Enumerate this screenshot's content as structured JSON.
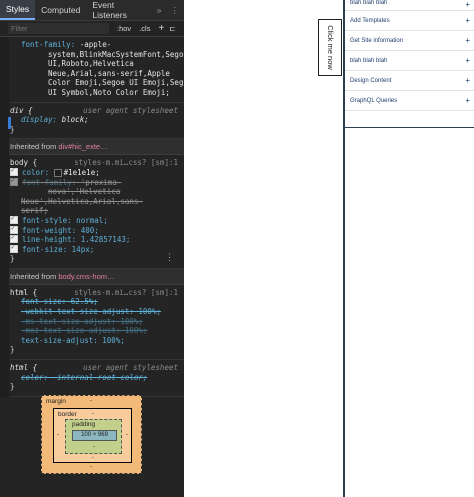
{
  "devtools": {
    "tabs": [
      "Styles",
      "Computed",
      "Event Listeners",
      "»",
      "⋮"
    ],
    "filter": {
      "placeholder": "Filter",
      "hov": ":hov",
      "cls": ".cls",
      "plus": "+",
      "sidebar": "⊏"
    },
    "font_rule": {
      "prop": "font-family:",
      "lines": [
        "-apple-",
        "system,BlinkMacSystemFont,Segoe",
        "UI,Roboto,Helvetica",
        "Neue,Arial,sans-serif,Apple",
        "Color Emoji,Segoe UI Emoji,Segoe",
        "UI Symbol,Noto Color Emoji;"
      ]
    },
    "div_rule": {
      "selector": "div {",
      "source": "user agent stylesheet",
      "prop": "display:",
      "val": "block;",
      "close": "}"
    },
    "inherited1": {
      "label": "Inherited from",
      "element": "div#hic_exte…"
    },
    "body_rule": {
      "selector": "body {",
      "source": "styles-m.mi…css? [sm]:1",
      "color_prop": "color:",
      "color_val": "#1e1e1e;",
      "font_family_prop": "font-family:",
      "font_family_val": "'proxima-",
      "font_family_l2": "nova','Helvetica",
      "font_family_l3": "Neue',Helvetica,Arial,sans-",
      "font_family_l4": "serif;",
      "font_style": "font-style: normal;",
      "font_weight": "font-weight: 400;",
      "line_height": "line-height: 1.42857143;",
      "font_size": "font-size: 14px;",
      "close": "}"
    },
    "inherited2": {
      "label": "Inherited from",
      "element": "body.cms-hom…"
    },
    "html_rule": {
      "selector": "html {",
      "source": "styles-m.mi…css? [sm]:1",
      "l1": "font-size: 62.5%;",
      "l2": "-webkit-text-size-adjust: 100%;",
      "l3": "-ms-text-size-adjust: 100%;",
      "l4": "-moz-text-size-adjust: 100%;",
      "l5": "text-size-adjust: 100%;",
      "close": "}"
    },
    "html_ua_rule": {
      "selector": "html {",
      "source": "user agent stylesheet",
      "l1": "color: -internal-root-color;",
      "close": "}"
    },
    "box_model": {
      "margin": "margin",
      "border": "border",
      "padding": "padding",
      "content": "100 × 969",
      "dash": "-"
    }
  },
  "page": {
    "feedback": "Click me now",
    "sidebar_items": [
      {
        "label": "blah blah blah",
        "icon": "plus-icon"
      },
      {
        "label": "Add Templates",
        "icon": "plus-icon"
      },
      {
        "label": "Get Site information",
        "icon": "plus-icon"
      },
      {
        "label": "blah blah blah",
        "icon": "plus-icon"
      },
      {
        "label": "Design Content",
        "icon": "plus-icon"
      },
      {
        "label": "GraphQL Queries",
        "icon": "plus-icon"
      }
    ],
    "plus_glyph": "+"
  }
}
